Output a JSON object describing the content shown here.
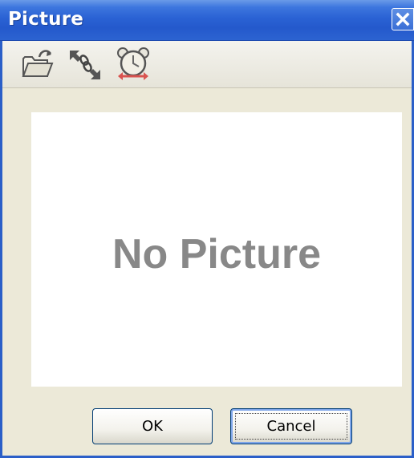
{
  "window": {
    "title": "Picture",
    "close_icon": "close-icon",
    "titlebar_color": "#2459cc"
  },
  "toolbar": {
    "items": [
      {
        "name": "open-folder",
        "icon": "open-folder-icon"
      },
      {
        "name": "resize",
        "icon": "resize-link-icon"
      },
      {
        "name": "alarm-clock",
        "icon": "alarm-clock-icon"
      }
    ]
  },
  "picture": {
    "placeholder_text": "No Picture",
    "placeholder_color": "#888888"
  },
  "buttons": {
    "ok_label": "OK",
    "cancel_label": "Cancel"
  }
}
